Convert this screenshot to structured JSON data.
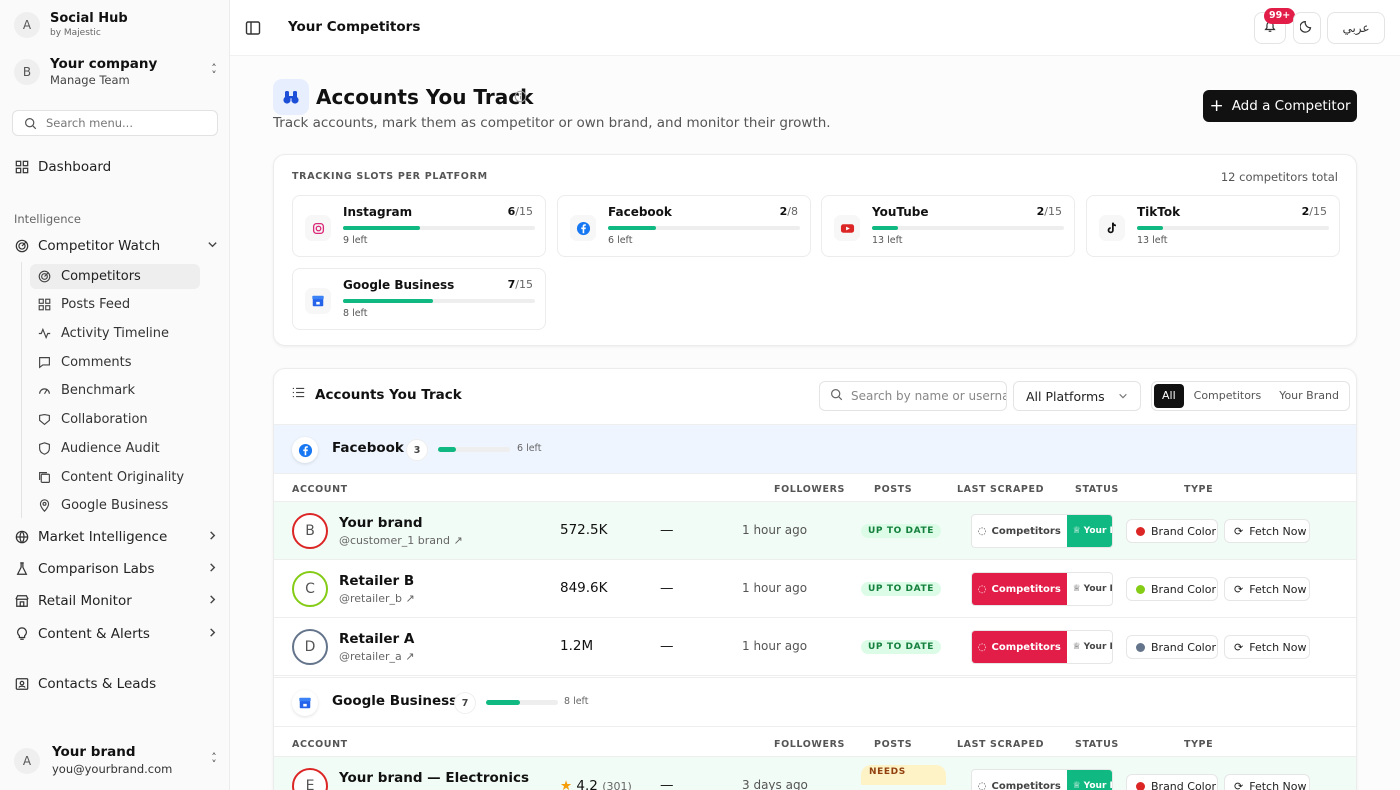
{
  "app": {
    "name": "Social Hub",
    "byline": "by Majestic",
    "avatar": "A"
  },
  "company": {
    "avatar": "B",
    "name": "Your company",
    "sub": "Manage Team"
  },
  "search": {
    "placeholder": "Search menu..."
  },
  "nav": {
    "dashboard": "Dashboard",
    "section_intelligence": "Intelligence",
    "competitor_watch": "Competitor Watch",
    "sub": [
      "Competitors",
      "Posts Feed",
      "Activity Timeline",
      "Comments",
      "Benchmark",
      "Collaboration",
      "Audience Audit",
      "Content Originality",
      "Google Business"
    ],
    "market_intelligence": "Market Intelligence",
    "comparison_labs": "Comparison Labs",
    "retail_monitor": "Retail Monitor",
    "content_alerts": "Content & Alerts",
    "contacts_leads": "Contacts & Leads"
  },
  "user": {
    "avatar": "A",
    "name": "Your brand",
    "email": "you@yourbrand.com"
  },
  "topbar": {
    "title": "Your Competitors",
    "notif_badge": "99+",
    "lang": "عربي"
  },
  "header": {
    "title": "Accounts You Track",
    "subtitle": "Track accounts, mark them as competitor or own brand, and monitor their growth.",
    "add_button": "Add a Competitor"
  },
  "slots": {
    "title": "TRACKING SLOTS PER PLATFORM",
    "total": "12 competitors total",
    "items": [
      {
        "name": "Instagram",
        "used": "6",
        "max": "/15",
        "left": "9 left",
        "fill": 0.4
      },
      {
        "name": "Facebook",
        "used": "2",
        "max": "/8",
        "left": "6 left",
        "fill": 0.25
      },
      {
        "name": "YouTube",
        "used": "2",
        "max": "/15",
        "left": "13 left",
        "fill": 0.133
      },
      {
        "name": "TikTok",
        "used": "2",
        "max": "/15",
        "left": "13 left",
        "fill": 0.133
      },
      {
        "name": "Google Business",
        "used": "7",
        "max": "/15",
        "left": "8 left",
        "fill": 0.467
      }
    ]
  },
  "table": {
    "title": "Accounts You Track",
    "search_placeholder": "Search by name or username",
    "platform_select": "All Platforms",
    "filters": [
      "All",
      "Competitors",
      "Your Brand"
    ],
    "headers": [
      "ACCOUNT",
      "FOLLOWERS",
      "POSTS",
      "LAST SCRAPED",
      "STATUS",
      "TYPE"
    ],
    "type_competitors": "Competitors",
    "type_brand": "Your Brand",
    "brand_color": "Brand Color",
    "fetch_now": "Fetch Now",
    "groups": [
      {
        "name": "Facebook",
        "count": "3",
        "left": "6 left",
        "fill": 0.25,
        "rows": [
          {
            "avatar": "B",
            "name": "Your brand",
            "handle": "@customer_1 brand",
            "followers": "572.5K",
            "posts": "—",
            "scraped": "1 hour ago",
            "status": "UP TO DATE",
            "type": "brand",
            "color": "#dc2626",
            "ring": "#dc2626"
          },
          {
            "avatar": "C",
            "name": "Retailer B",
            "handle": "@retailer_b",
            "followers": "849.6K",
            "posts": "—",
            "scraped": "1 hour ago",
            "status": "UP TO DATE",
            "type": "competitor",
            "color": "#84cc16",
            "ring": "#84cc16"
          },
          {
            "avatar": "D",
            "name": "Retailer A",
            "handle": "@retailer_a",
            "followers": "1.2M",
            "posts": "—",
            "scraped": "1 hour ago",
            "status": "UP TO DATE",
            "type": "competitor",
            "color": "#64748b",
            "ring": "#64748b"
          }
        ]
      },
      {
        "name": "Google Business",
        "count": "7",
        "left": "8 left",
        "fill": 0.467,
        "rows": [
          {
            "avatar": "E",
            "name": "Your brand — Electronics",
            "rating": "4.2",
            "reviews": "(301)",
            "posts": "—",
            "scraped": "3 days ago",
            "status": "NEEDS",
            "type": "brand",
            "color": "#dc2626",
            "ring": "#dc2626"
          }
        ]
      }
    ]
  },
  "colors": {
    "accent": "#10b981",
    "danger": "#e11d48",
    "dark": "#111111"
  }
}
